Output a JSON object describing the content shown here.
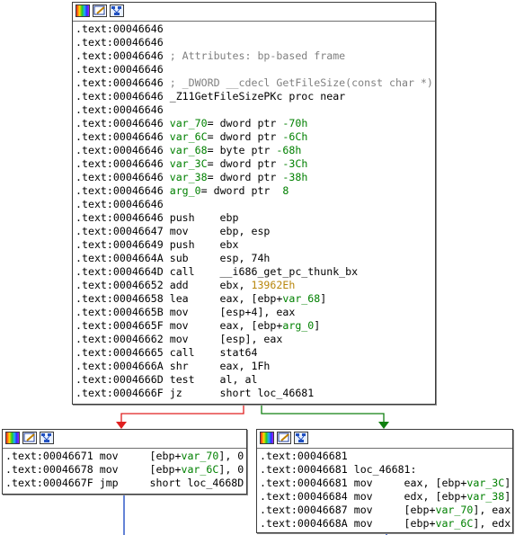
{
  "main_block": {
    "lines": [
      {
        "addr": ".text:00046646",
        "parts": []
      },
      {
        "addr": ".text:00046646",
        "parts": []
      },
      {
        "addr": ".text:00046646",
        "parts": [
          {
            "t": "; Attributes: bp-based frame",
            "c": "cmt"
          }
        ]
      },
      {
        "addr": ".text:00046646",
        "parts": []
      },
      {
        "addr": ".text:00046646",
        "parts": [
          {
            "t": "; _DWORD __cdecl GetFileSize(const char *)",
            "c": "cmt"
          }
        ]
      },
      {
        "addr": ".text:00046646",
        "parts": [
          {
            "t": "_Z11GetFileSizePKc proc near",
            "c": "nm"
          }
        ]
      },
      {
        "addr": ".text:00046646",
        "parts": []
      },
      {
        "addr": ".text:00046646",
        "parts": [
          {
            "t": "var_70",
            "c": "var"
          },
          {
            "t": "= dword ptr ",
            "c": "nm"
          },
          {
            "t": "-70h",
            "c": "num"
          }
        ]
      },
      {
        "addr": ".text:00046646",
        "parts": [
          {
            "t": "var_6C",
            "c": "var"
          },
          {
            "t": "= dword ptr ",
            "c": "nm"
          },
          {
            "t": "-6Ch",
            "c": "num"
          }
        ]
      },
      {
        "addr": ".text:00046646",
        "parts": [
          {
            "t": "var_68",
            "c": "var"
          },
          {
            "t": "= byte ptr ",
            "c": "nm"
          },
          {
            "t": "-68h",
            "c": "num"
          }
        ]
      },
      {
        "addr": ".text:00046646",
        "parts": [
          {
            "t": "var_3C",
            "c": "var"
          },
          {
            "t": "= dword ptr ",
            "c": "nm"
          },
          {
            "t": "-3Ch",
            "c": "num"
          }
        ]
      },
      {
        "addr": ".text:00046646",
        "parts": [
          {
            "t": "var_38",
            "c": "var"
          },
          {
            "t": "= dword ptr ",
            "c": "nm"
          },
          {
            "t": "-38h",
            "c": "num"
          }
        ]
      },
      {
        "addr": ".text:00046646",
        "parts": [
          {
            "t": "arg_0",
            "c": "var"
          },
          {
            "t": "= dword ptr  ",
            "c": "nm"
          },
          {
            "t": "8",
            "c": "num"
          }
        ]
      },
      {
        "addr": ".text:00046646",
        "parts": []
      },
      {
        "addr": ".text:00046646",
        "parts": [
          {
            "t": "push    ebp",
            "c": "nm"
          }
        ]
      },
      {
        "addr": ".text:00046647",
        "parts": [
          {
            "t": "mov     ebp, esp",
            "c": "nm"
          }
        ]
      },
      {
        "addr": ".text:00046649",
        "parts": [
          {
            "t": "push    ebx",
            "c": "nm"
          }
        ]
      },
      {
        "addr": ".text:0004664A",
        "parts": [
          {
            "t": "sub     esp, 74h",
            "c": "nm"
          }
        ]
      },
      {
        "addr": ".text:0004664D",
        "parts": [
          {
            "t": "call    __i686_get_pc_thunk_bx",
            "c": "nm"
          }
        ]
      },
      {
        "addr": ".text:00046652",
        "parts": [
          {
            "t": "add     ebx, ",
            "c": "nm"
          },
          {
            "t": "13962Eh",
            "c": "hex"
          }
        ]
      },
      {
        "addr": ".text:00046658",
        "parts": [
          {
            "t": "lea     eax, [ebp+",
            "c": "nm"
          },
          {
            "t": "var_68",
            "c": "var"
          },
          {
            "t": "]",
            "c": "nm"
          }
        ]
      },
      {
        "addr": ".text:0004665B",
        "parts": [
          {
            "t": "mov     [esp+4], eax",
            "c": "nm"
          }
        ]
      },
      {
        "addr": ".text:0004665F",
        "parts": [
          {
            "t": "mov     eax, [ebp+",
            "c": "nm"
          },
          {
            "t": "arg_0",
            "c": "var"
          },
          {
            "t": "]",
            "c": "nm"
          }
        ]
      },
      {
        "addr": ".text:00046662",
        "parts": [
          {
            "t": "mov     [esp], eax",
            "c": "nm"
          }
        ]
      },
      {
        "addr": ".text:00046665",
        "parts": [
          {
            "t": "call    stat64",
            "c": "nm"
          }
        ]
      },
      {
        "addr": ".text:0004666A",
        "parts": [
          {
            "t": "shr     eax, 1Fh",
            "c": "nm"
          }
        ]
      },
      {
        "addr": ".text:0004666D",
        "parts": [
          {
            "t": "test    al, al",
            "c": "nm"
          }
        ]
      },
      {
        "addr": ".text:0004666F",
        "parts": [
          {
            "t": "jz      short loc_46681",
            "c": "nm"
          }
        ]
      }
    ]
  },
  "left_block": {
    "lines": [
      {
        "addr": ".text:00046671",
        "parts": [
          {
            "t": "mov     [ebp+",
            "c": "nm"
          },
          {
            "t": "var_70",
            "c": "var"
          },
          {
            "t": "], 0",
            "c": "nm"
          }
        ]
      },
      {
        "addr": ".text:00046678",
        "parts": [
          {
            "t": "mov     [ebp+",
            "c": "nm"
          },
          {
            "t": "var_6C",
            "c": "var"
          },
          {
            "t": "], 0",
            "c": "nm"
          }
        ]
      },
      {
        "addr": ".text:0004667F",
        "parts": [
          {
            "t": "jmp     short loc_4668D",
            "c": "nm"
          }
        ]
      }
    ]
  },
  "right_block": {
    "lines": [
      {
        "addr": ".text:00046681",
        "parts": []
      },
      {
        "addr": ".text:00046681",
        "parts": [
          {
            "t": "loc_46681:",
            "c": "nm"
          }
        ]
      },
      {
        "addr": ".text:00046681",
        "parts": [
          {
            "t": "mov     eax, [ebp+",
            "c": "nm"
          },
          {
            "t": "var_3C",
            "c": "var"
          },
          {
            "t": "]",
            "c": "nm"
          }
        ]
      },
      {
        "addr": ".text:00046684",
        "parts": [
          {
            "t": "mov     edx, [ebp+",
            "c": "nm"
          },
          {
            "t": "var_38",
            "c": "var"
          },
          {
            "t": "]",
            "c": "nm"
          }
        ]
      },
      {
        "addr": ".text:00046687",
        "parts": [
          {
            "t": "mov     [ebp+",
            "c": "nm"
          },
          {
            "t": "var_70",
            "c": "var"
          },
          {
            "t": "], eax",
            "c": "nm"
          }
        ]
      },
      {
        "addr": ".text:0004668A",
        "parts": [
          {
            "t": "mov     [ebp+",
            "c": "nm"
          },
          {
            "t": "var_6C",
            "c": "var"
          },
          {
            "t": "], edx",
            "c": "nm"
          }
        ]
      }
    ]
  },
  "edges": {
    "false_color": "#e02020",
    "true_color": "#108010",
    "flow_color": "#1040c0"
  },
  "icons": [
    "color-palette-icon",
    "edit-pencil-icon",
    "graph-view-icon"
  ]
}
